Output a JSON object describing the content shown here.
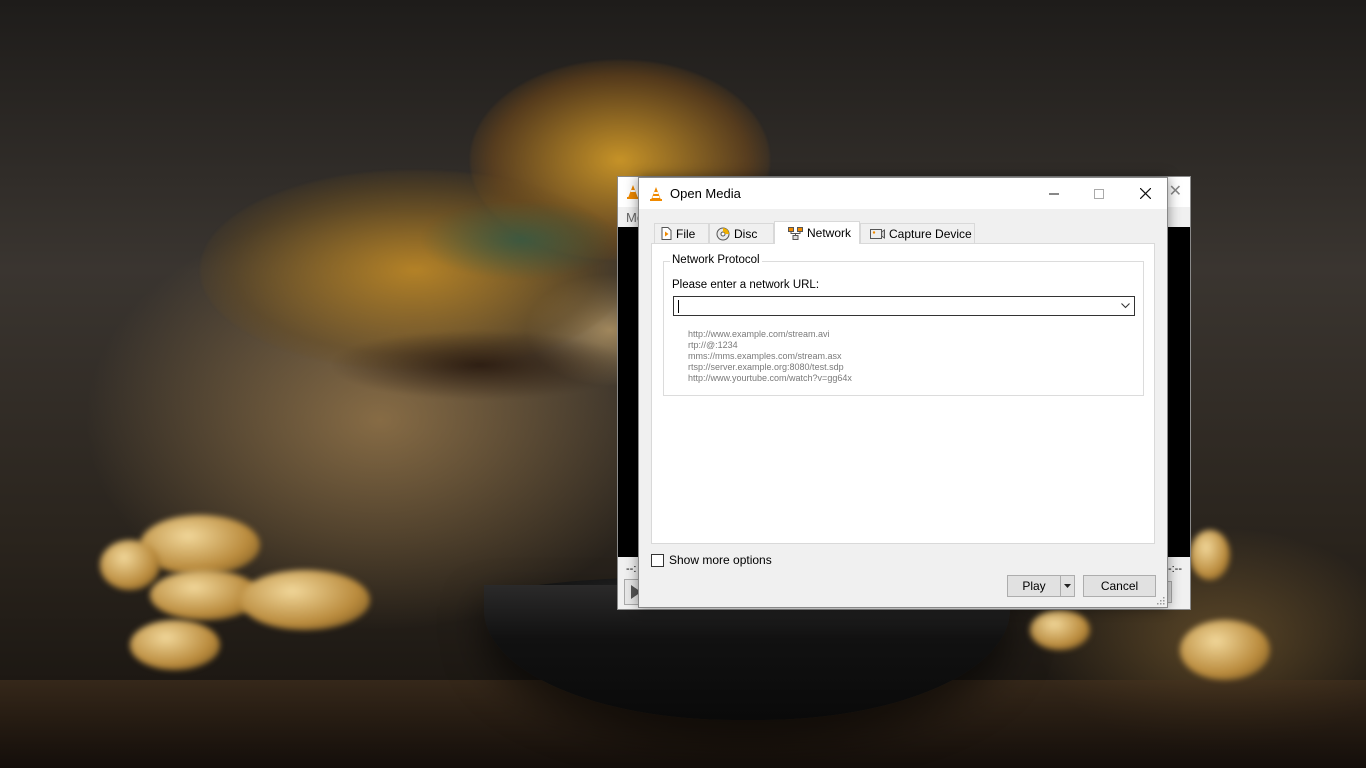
{
  "main_window": {
    "menu_partial": "Me",
    "time_left": "--:",
    "time_right": "--:--"
  },
  "dialog": {
    "title": "Open Media",
    "tabs": [
      {
        "label": "File",
        "icon": "file-icon"
      },
      {
        "label": "Disc",
        "icon": "disc-icon"
      },
      {
        "label": "Network",
        "icon": "network-icon",
        "active": true
      },
      {
        "label": "Capture Device",
        "icon": "capture-device-icon"
      }
    ],
    "network": {
      "group_title": "Network Protocol",
      "url_label": "Please enter a network URL:",
      "url_value": "",
      "examples": [
        "http://www.example.com/stream.avi",
        "rtp://@:1234",
        "mms://mms.examples.com/stream.asx",
        "rtsp://server.example.org:8080/test.sdp",
        "http://www.yourtube.com/watch?v=gg64x"
      ]
    },
    "show_more_options": "Show more options",
    "show_more_checked": false,
    "play_label": "Play",
    "cancel_label": "Cancel"
  },
  "colors": {
    "vlc_orange": "#f08a00",
    "dialog_bg": "#f0f0f0",
    "panel_bg": "#ffffff"
  }
}
